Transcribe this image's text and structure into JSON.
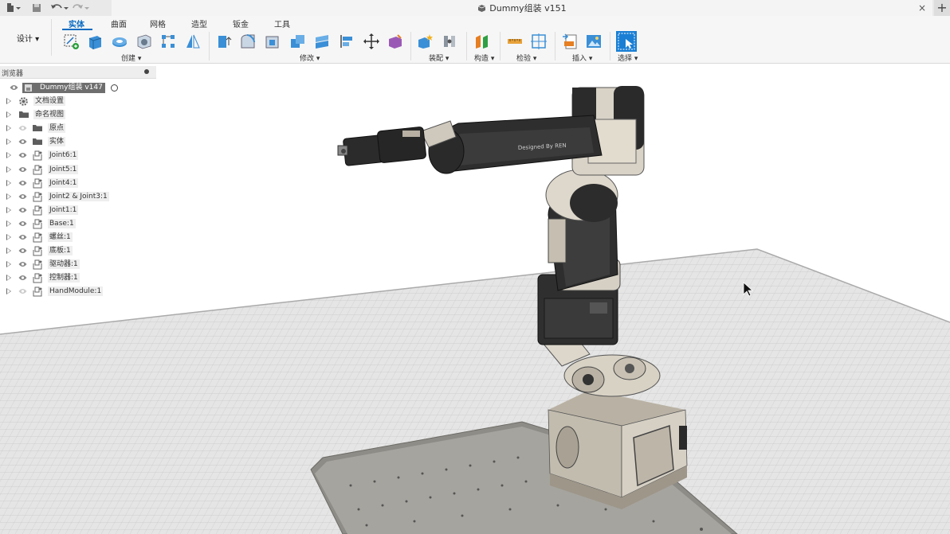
{
  "title_bar": {
    "document_title": "Dummy组装 v151",
    "icons": [
      "file-menu-icon",
      "save-icon",
      "undo-icon",
      "redo-icon",
      "close-tab-icon",
      "new-tab-icon"
    ]
  },
  "toolbar": {
    "workspace_label": "设计 ▾",
    "tabs": [
      {
        "label": "实体",
        "active": true
      },
      {
        "label": "曲面",
        "active": false
      },
      {
        "label": "网格",
        "active": false
      },
      {
        "label": "造型",
        "active": false
      },
      {
        "label": "钣金",
        "active": false
      },
      {
        "label": "工具",
        "active": false
      }
    ],
    "groups": [
      {
        "label": "创建 ▾"
      },
      {
        "label": "修改 ▾"
      },
      {
        "label": "装配 ▾"
      },
      {
        "label": "构造 ▾"
      },
      {
        "label": "检验 ▾"
      },
      {
        "label": "插入 ▾"
      },
      {
        "label": "选择 ▾"
      }
    ],
    "accent_color": "#0a6bc1"
  },
  "browser": {
    "header_label": "浏览器",
    "root_label": "Dummy组装 v147",
    "nodes": [
      {
        "label": "文档设置",
        "icon": "gear-icon"
      },
      {
        "label": "命名视图",
        "icon": "folder-icon"
      },
      {
        "label": "原点",
        "icon": "folder-icon"
      },
      {
        "label": "实体",
        "icon": "folder-icon"
      },
      {
        "label": "Joint6:1",
        "icon": "component-icon"
      },
      {
        "label": "Joint5:1",
        "icon": "component-icon"
      },
      {
        "label": "Joint4:1",
        "icon": "component-icon"
      },
      {
        "label": "Joint2 & Joint3:1",
        "icon": "component-icon"
      },
      {
        "label": "Joint1:1",
        "icon": "component-icon"
      },
      {
        "label": "Base:1",
        "icon": "component-icon"
      },
      {
        "label": "螺丝:1",
        "icon": "component-icon"
      },
      {
        "label": "底板:1",
        "icon": "component-icon"
      },
      {
        "label": "驱动器:1",
        "icon": "component-icon"
      },
      {
        "label": "控制器:1",
        "icon": "component-icon"
      },
      {
        "label": "HandModule:1",
        "icon": "component-icon"
      }
    ]
  },
  "viewport": {
    "arm_text": "Designed By REN"
  }
}
